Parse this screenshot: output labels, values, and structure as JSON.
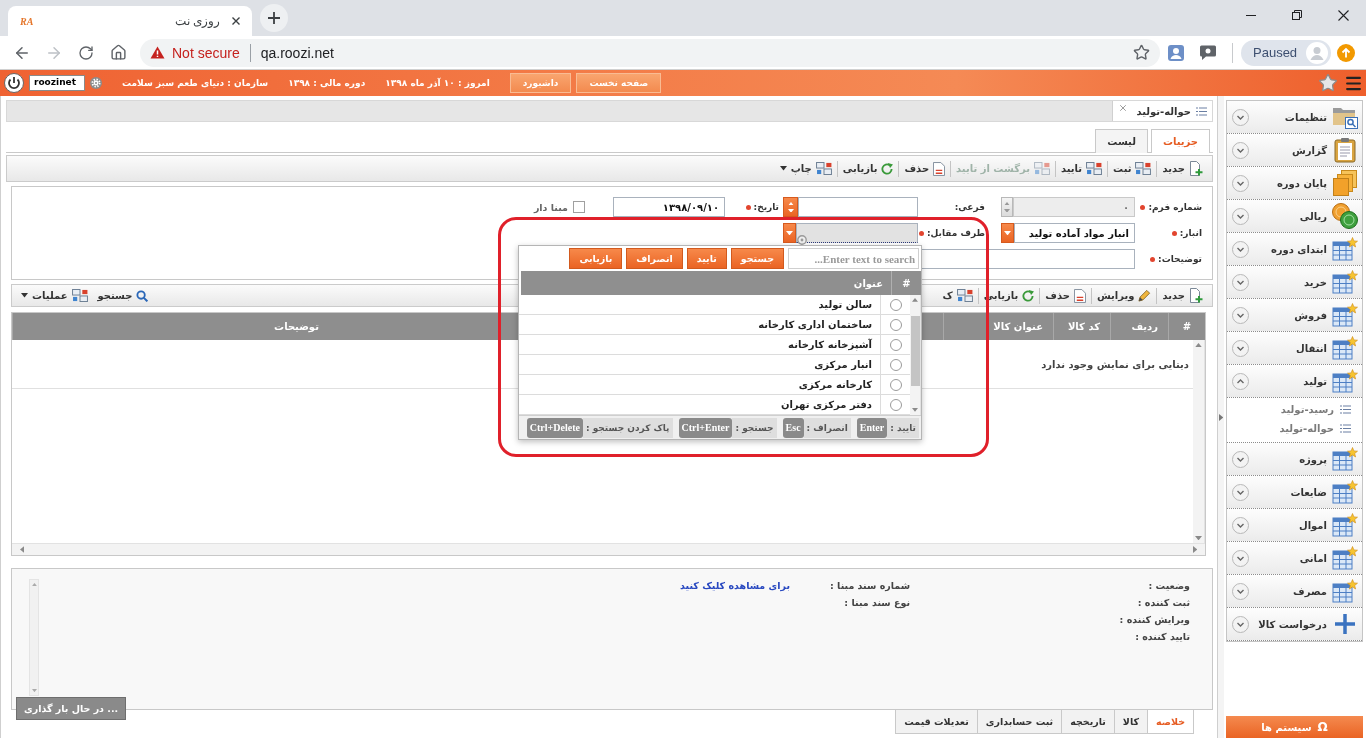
{
  "browser": {
    "tab": {
      "favicon": "RA",
      "title": "روزی نت"
    },
    "security": "Not secure",
    "url": "qa.roozi.net",
    "profile": "Paused"
  },
  "header": {
    "nav_buttons": [
      "صفحه نخست",
      "داشبورد"
    ],
    "info": [
      "امروز : ۱۰ آذر ماه ۱۳۹۸",
      "دوره مالی : ۱۳۹۸",
      "سازمان : دنیای طعم سبز سلامت"
    ],
    "user": "roozinet"
  },
  "document_tabs": [
    {
      "label": "حواله-تولید",
      "selected": true
    }
  ],
  "view_tabs": [
    {
      "label": "جزییات",
      "selected": true
    },
    {
      "label": "لیست",
      "selected": false
    }
  ],
  "toolbar": [
    {
      "kind": "new",
      "label": "جدید",
      "disabled": false,
      "menu": false
    },
    {
      "kind": "save",
      "label": "ثبت",
      "disabled": false,
      "menu": false
    },
    {
      "kind": "approve",
      "label": "تایید",
      "disabled": false,
      "menu": false
    },
    {
      "kind": "unapprove",
      "label": "برگشت از تایید",
      "disabled": true,
      "menu": false
    },
    {
      "kind": "delete",
      "label": "حذف",
      "disabled": false,
      "menu": false
    },
    {
      "kind": "restore",
      "label": "بازیابی",
      "disabled": false,
      "menu": false
    },
    {
      "kind": "print",
      "label": "چاپ",
      "disabled": false,
      "menu": true
    }
  ],
  "form": {
    "rows": [
      [
        {
          "kind": "number",
          "label": "شماره فرم:",
          "required": true,
          "disabled": true,
          "value": "۰"
        },
        {
          "kind": "number",
          "label": "فرعی:",
          "required": false,
          "disabled": false
        },
        {
          "kind": "date",
          "label": "تاریخ:",
          "required": true,
          "value": "۱۳۹۸/۰۹/۱۰"
        },
        {
          "kind": "checkbox",
          "label": "مبنا دار",
          "checked": false
        }
      ],
      [
        {
          "kind": "combo",
          "label": "انبار:",
          "required": true,
          "open": false,
          "value": "انبار مواد آماده تولید"
        },
        {
          "kind": "combo",
          "label": "طرف مقابل:",
          "required": true,
          "open": true
        }
      ],
      [
        {
          "kind": "text",
          "label": "توضیحات:",
          "required": true
        }
      ]
    ]
  },
  "items_toolbar": {
    "actions": [
      {
        "kind": "new",
        "label": "جدید",
        "disabled": false,
        "menu": false
      },
      {
        "kind": "edit",
        "label": "ویرایش",
        "disabled": false,
        "menu": false
      },
      {
        "kind": "delete",
        "label": "حذف",
        "disabled": false,
        "menu": false
      },
      {
        "kind": "restore",
        "label": "بازیابی",
        "disabled": false,
        "menu": false
      },
      {
        "kind": "copy",
        "label": "ک",
        "disabled": false,
        "menu": false
      }
    ],
    "tools": [
      {
        "kind": "search",
        "label": "جستجو",
        "disabled": false,
        "menu": false
      },
      {
        "kind": "operations",
        "label": "عملیات",
        "disabled": false,
        "menu": true
      }
    ]
  },
  "grid": {
    "columns": [
      "#",
      "ردیف",
      "کد کالا",
      "عنوان کالا",
      "توضیحات"
    ],
    "empty_message": "دیتایی برای نمایش وجود ندارد"
  },
  "dropdown": {
    "search_placeholder": "Enter text to search...",
    "buttons": [
      "جستجو",
      "تایید",
      "انصراف",
      "بازیابی"
    ],
    "columns": [
      "#",
      "عنوان"
    ],
    "options": [
      {
        "label": "سالن تولید",
        "selected": false
      },
      {
        "label": "ساختمان اداری کارخانه",
        "selected": false
      },
      {
        "label": "آشپزخانه کارخانه",
        "selected": false
      },
      {
        "label": "انبار مرکزی",
        "selected": false
      },
      {
        "label": "کارخانه مرکزی",
        "selected": false
      },
      {
        "label": "دفتر مرکزی تهران",
        "selected": false
      }
    ],
    "shortcuts": [
      {
        "label": "تایید :",
        "key": "Enter"
      },
      {
        "label": "انصراف :",
        "key": "Esc"
      },
      {
        "label": "جستجو :",
        "key": "Ctrl+Enter"
      },
      {
        "label": "پاک کردن جستجو :",
        "key": "Ctrl+Delete"
      }
    ]
  },
  "summary": {
    "columns": [
      [
        "وضعیت :",
        "ثبت کننده :",
        "ویرایش کننده :",
        "تایید کننده :"
      ],
      [
        "شماره سند مبنا :",
        "نوع سند مبنا :"
      ]
    ],
    "link": "برای مشاهده کلیک کنید"
  },
  "loading_toast": "در حال بار گذاری ...",
  "bottom_tabs": [
    {
      "label": "خلاصه",
      "selected": true
    },
    {
      "label": "کالا",
      "selected": false
    },
    {
      "label": "تاریخچه",
      "selected": false
    },
    {
      "label": "ثبت حسابداری",
      "selected": false
    },
    {
      "label": "تعدیلات قیمت",
      "selected": false
    }
  ],
  "sidebar": {
    "items": [
      {
        "kind": "settings",
        "label": "تنظیمات",
        "expanded": false
      },
      {
        "kind": "report",
        "label": "گزارش",
        "expanded": false
      },
      {
        "kind": "archive",
        "label": "پایان دوره",
        "expanded": false
      },
      {
        "kind": "currency",
        "label": "ریالی",
        "expanded": false
      },
      {
        "kind": "table",
        "label": "ابتدای دوره",
        "expanded": false
      },
      {
        "kind": "table",
        "label": "خرید",
        "expanded": false
      },
      {
        "kind": "table",
        "label": "فروش",
        "expanded": false
      },
      {
        "kind": "table",
        "label": "انتقال",
        "expanded": false
      },
      {
        "kind": "table",
        "label": "تولید",
        "expanded": true,
        "children": [
          {
            "label": "رسید-تولید"
          },
          {
            "label": "حواله-تولید"
          }
        ]
      },
      {
        "kind": "table",
        "label": "پروژه",
        "expanded": false
      },
      {
        "kind": "table",
        "label": "ضایعات",
        "expanded": false
      },
      {
        "kind": "table",
        "label": "اموال",
        "expanded": false
      },
      {
        "kind": "table",
        "label": "امانی",
        "expanded": false
      },
      {
        "kind": "table",
        "label": "مصرف",
        "expanded": false
      },
      {
        "kind": "add",
        "label": "درخواست کالا",
        "expanded": false
      }
    ],
    "footer": {
      "symbol": "Ω",
      "label": "سیستم ها"
    }
  }
}
